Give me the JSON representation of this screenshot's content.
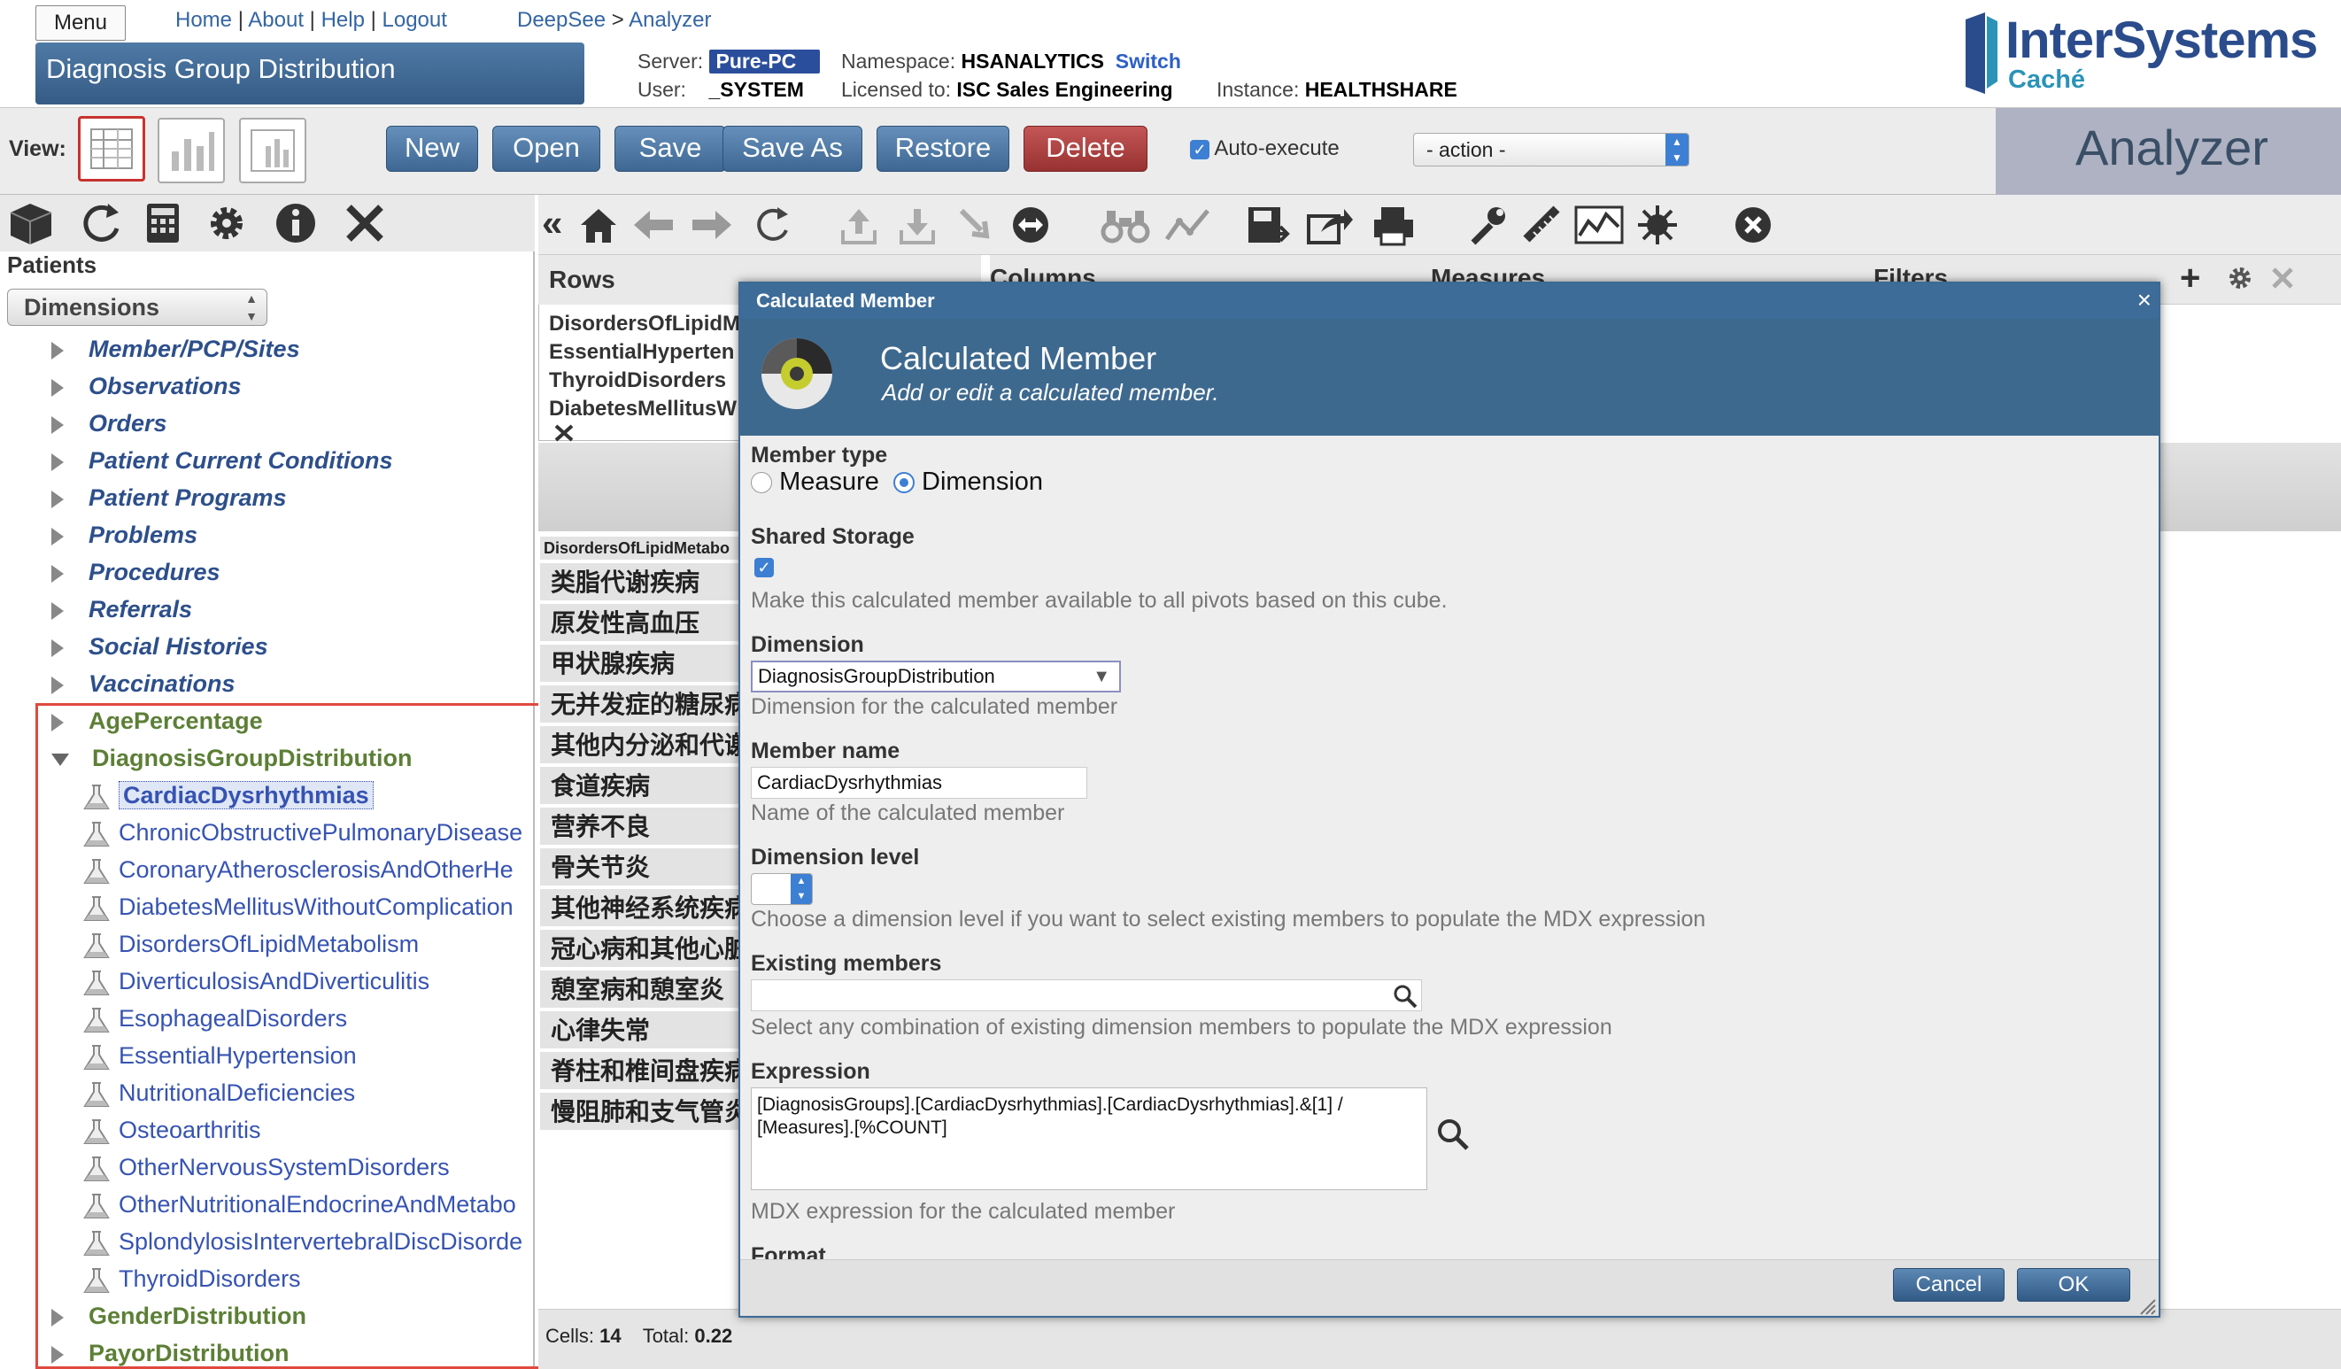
{
  "header": {
    "menu_label": "Menu",
    "links": [
      "Home",
      "About",
      "Help",
      "Logout"
    ],
    "breadcrumb": [
      "DeepSee",
      "Analyzer"
    ],
    "page_title": "Diagnosis Group Distribution",
    "server_label": "Server:",
    "server_value": "Pure-PC",
    "namespace_label": "Namespace:",
    "namespace_value": "HSANALYTICS",
    "switch_label": "Switch",
    "user_label": "User:",
    "user_value": "_SYSTEM",
    "licensed_label": "Licensed to:",
    "licensed_value": "ISC Sales Engineering",
    "instance_label": "Instance:",
    "instance_value": "HEALTHSHARE",
    "logo_name": "InterSystems",
    "logo_sub": "Caché"
  },
  "toolbar": {
    "view_label": "View:",
    "new": "New",
    "open": "Open",
    "save": "Save",
    "save_as": "Save As",
    "restore": "Restore",
    "delete": "Delete",
    "auto_execute": "Auto-execute",
    "action": "- action -",
    "analyzer": "Analyzer"
  },
  "left": {
    "subject": "Patients",
    "dimensions_select": "Dimensions",
    "dim_items": [
      "Member/PCP/Sites",
      "Observations",
      "Orders",
      "Patient Current Conditions",
      "Patient Programs",
      "Problems",
      "Procedures",
      "Referrals",
      "Social Histories",
      "Vaccinations"
    ],
    "group_age": "AgePercentage",
    "group_diag": "DiagnosisGroupDistribution",
    "members": [
      "CardiacDysrhythmias",
      "ChronicObstructivePulmonaryDisease",
      "CoronaryAtherosclerosisAndOtherHe",
      "DiabetesMellitusWithoutComplication",
      "DisordersOfLipidMetabolism",
      "DiverticulosisAndDiverticulitis",
      "EsophagealDisorders",
      "EssentialHypertension",
      "NutritionalDeficiencies",
      "Osteoarthritis",
      "OtherNervousSystemDisorders",
      "OtherNutritionalEndocrineAndMetabo",
      "SplondylosisIntervertebralDiscDisorde",
      "ThyroidDisorders"
    ],
    "group_gender": "GenderDistribution",
    "group_payor": "PayorDistribution"
  },
  "pivot": {
    "rows_label": "Rows",
    "columns_label": "Columns",
    "measures_label": "Measures",
    "filters_label": "Filters",
    "rows_items": [
      "DisordersOfLipidM",
      "EssentialHyperten",
      "ThyroidDisorders",
      "DiabetesMellitusW"
    ],
    "grid_header": "DisordersOfLipidMetabo",
    "grid_rows": [
      "类脂代谢疾病",
      "原发性高血压",
      "甲状腺疾病",
      "无并发症的糖尿病",
      "其他内分泌和代谢",
      "食道疾病",
      "营养不良",
      "骨关节炎",
      "其他神经系统疾病",
      "冠心病和其他心脏",
      "憩室病和憩室炎",
      "心律失常",
      "脊柱和椎间盘疾病",
      "慢阻肺和支气管炎"
    ],
    "cells_label": "Cells:",
    "cells_value": "14",
    "total_label": "Total:",
    "total_value": "0.22"
  },
  "dialog": {
    "title_bar": "Calculated Member",
    "heading": "Calculated Member",
    "subheading": "Add or edit a calculated member.",
    "member_type_label": "Member type",
    "measure_option": "Measure",
    "dimension_option": "Dimension",
    "shared_storage_label": "Shared Storage",
    "shared_storage_hint": "Make this calculated member available to all pivots based on this cube.",
    "dimension_label": "Dimension",
    "dimension_value": "DiagnosisGroupDistribution",
    "dimension_hint": "Dimension for the calculated member",
    "member_name_label": "Member name",
    "member_name_value": "CardiacDysrhythmias",
    "member_name_hint": "Name of the calculated member",
    "dimension_level_label": "Dimension level",
    "dimension_level_hint": "Choose a dimension level if you want to select existing members to populate the MDX expression",
    "existing_members_label": "Existing members",
    "existing_members_hint": "Select any combination of existing dimension members to populate the MDX expression",
    "expression_label": "Expression",
    "expression_value": "[DiagnosisGroups].[CardiacDysrhythmias].[CardiacDysrhythmias].&[1] / [Measures].[%COUNT]",
    "expression_hint": "MDX expression for the calculated member",
    "format_label": "Format",
    "cancel": "Cancel",
    "ok": "OK"
  },
  "colors": {
    "title_blue": "#3e698f",
    "button_blue": "#4a76a3",
    "delete_red": "#b04444",
    "selection_red": "#e0493e",
    "dim_text": "#2d4f8b",
    "group_text": "#5c7f36",
    "member_text": "#3653b2"
  }
}
